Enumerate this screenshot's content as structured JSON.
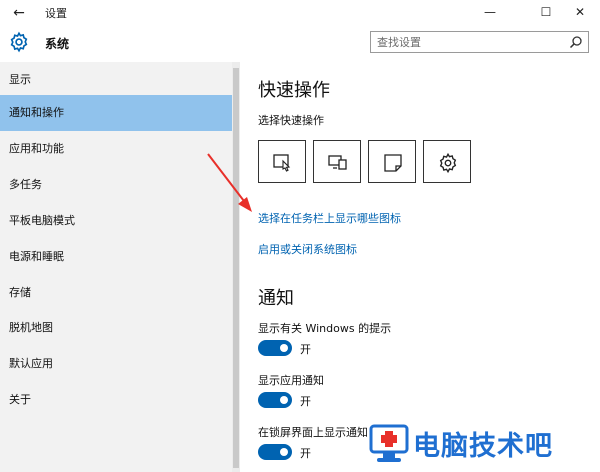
{
  "window": {
    "title": "设置",
    "back_glyph": "←",
    "min_glyph": "—",
    "max_glyph": "☐",
    "close_glyph": "✕"
  },
  "header": {
    "title": "系统",
    "search_placeholder": "查找设置"
  },
  "sidebar": {
    "items": [
      {
        "label": "显示"
      },
      {
        "label": "通知和操作",
        "selected": true
      },
      {
        "label": "应用和功能"
      },
      {
        "label": "多任务"
      },
      {
        "label": "平板电脑模式"
      },
      {
        "label": "电源和睡眠"
      },
      {
        "label": "存储"
      },
      {
        "label": "脱机地图"
      },
      {
        "label": "默认应用"
      },
      {
        "label": "关于"
      }
    ]
  },
  "main": {
    "quick_actions": {
      "heading": "快速操作",
      "subheading": "选择快速操作",
      "tiles": [
        "tablet-mode-icon",
        "project-icon",
        "note-icon",
        "gear-icon"
      ]
    },
    "links": {
      "taskbar_icons": "选择在任务栏上显示哪些图标",
      "system_icons": "启用或关闭系统图标"
    },
    "notifications": {
      "heading": "通知",
      "settings": [
        {
          "label": "显示有关 Windows 的提示",
          "state": "开",
          "on": true
        },
        {
          "label": "显示应用通知",
          "state": "开",
          "on": true
        },
        {
          "label": "在锁屏界面上显示通知",
          "state": "开",
          "on": true
        }
      ]
    }
  },
  "watermark": {
    "text": "电脑技术吧"
  },
  "colors": {
    "accent": "#0063b1",
    "selected_item": "#90c2ec",
    "sidebar_bg": "#f2f2f2",
    "annotation_arrow": "#e8302a",
    "watermark": "#1f6fd1"
  }
}
